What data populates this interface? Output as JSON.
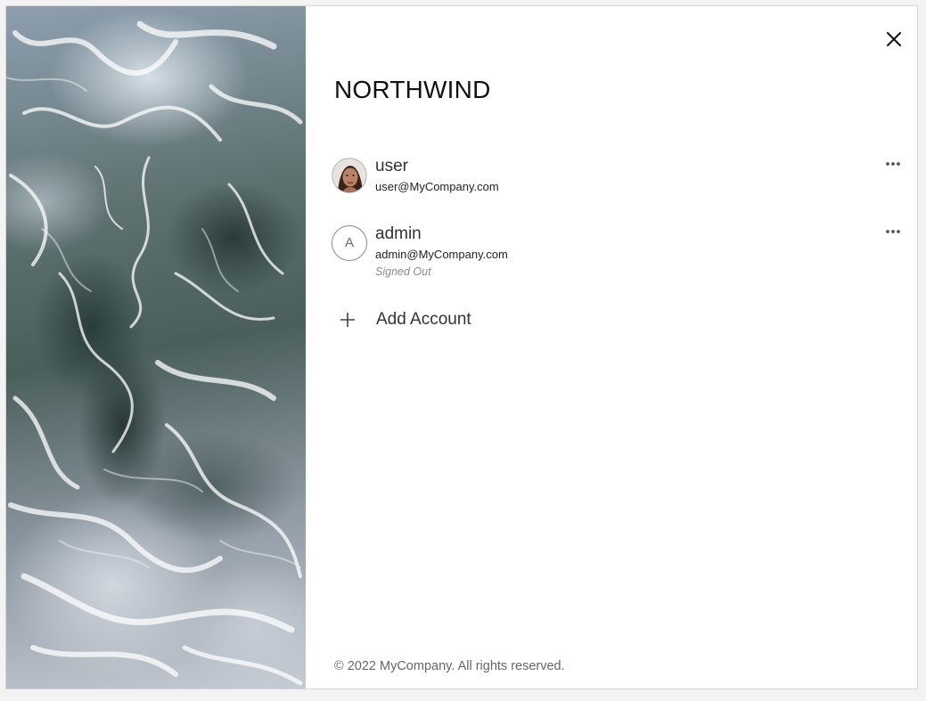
{
  "brand": {
    "title": "NORTHWIND"
  },
  "accounts": [
    {
      "name": "user",
      "email": "user@MyCompany.com",
      "status": "",
      "avatar": "photo"
    },
    {
      "name": "admin",
      "email": "admin@MyCompany.com",
      "status": "Signed Out",
      "avatar": "initial",
      "initial": "A"
    }
  ],
  "add_account": {
    "label": "Add Account",
    "icon": "plus-icon"
  },
  "footer": {
    "text": "© 2022 MyCompany. All rights reserved."
  },
  "icons": {
    "close": "close-icon",
    "more": "more-icon"
  },
  "colors": {
    "background": "#ffffff",
    "text_primary": "#333333",
    "text_muted": "#8a8a8a"
  }
}
